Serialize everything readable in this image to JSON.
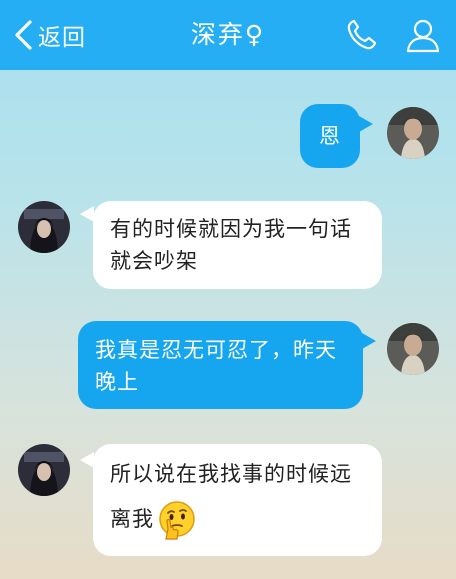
{
  "header": {
    "back_label": "返回",
    "title": "深弃♀",
    "icons": {
      "back": "chevron-left-icon",
      "phone": "phone-icon",
      "profile": "person-icon"
    }
  },
  "colors": {
    "header_bg": "#25aef4",
    "sent_bubble": "#16a5ef",
    "received_bubble": "#ffffff",
    "background_top": "#a6dff0",
    "background_bottom": "#e7dcc7"
  },
  "messages": [
    {
      "sender": "me",
      "text": "恩"
    },
    {
      "sender": "other",
      "text_lines": [
        "有的时候就因为我一句话",
        "就会吵架"
      ]
    },
    {
      "sender": "me",
      "text_lines": [
        "我真是忍无可忍了，昨天",
        "晚上"
      ]
    },
    {
      "sender": "other",
      "text_lines": [
        "所以说在我找事的时候远",
        "离我"
      ],
      "emoji": "thinking-face-emoji"
    }
  ]
}
